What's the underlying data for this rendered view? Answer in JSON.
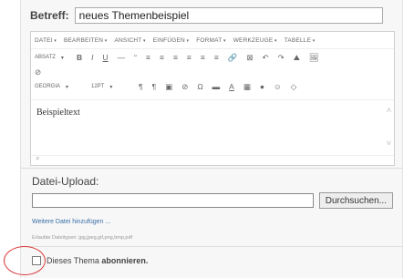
{
  "subject": {
    "label": "Betreff:",
    "value": "neues Themenbeispiel"
  },
  "editor": {
    "menubar": [
      "DATEI",
      "BEARBEITEN",
      "ANSICHT",
      "EINFÜGEN",
      "FORMAT",
      "WERKZEUGE",
      "TABELLE"
    ],
    "toolbar_row1": {
      "format_select": "ABSATZ",
      "glyphs": [
        "B",
        "I",
        "U",
        "—",
        "“",
        "≡",
        "≡",
        "≡",
        "≡",
        "≡",
        "≡",
        "🔗",
        "⊠",
        "↶",
        "↷",
        "⛰",
        "🖼"
      ]
    },
    "toolbar_row1b": [
      "⊘"
    ],
    "toolbar_row2": {
      "font_select": "GEORGIA",
      "size_select": "12PT",
      "glyphs": [
        "¶",
        "¶",
        "▣",
        "⊘",
        "Ω",
        "▬",
        "A",
        "▦",
        "●",
        "☺",
        "◇"
      ]
    },
    "content_text": "Beispieltext",
    "status_path": "p"
  },
  "upload": {
    "title": "Datei-Upload:",
    "browse_label": "Durchsuchen...",
    "add_link": "Weitere Datei hinzufügen ...",
    "allowed_types": "Erlaubte Dateitypen: jpg,jpeg,gif,png,bmp,pdf"
  },
  "subscribe": {
    "label_prefix": "Dieses Thema ",
    "label_bold": "abonnieren."
  },
  "colors": {
    "annotation_circle": "#d93a3a",
    "link": "#3a6ea5"
  }
}
